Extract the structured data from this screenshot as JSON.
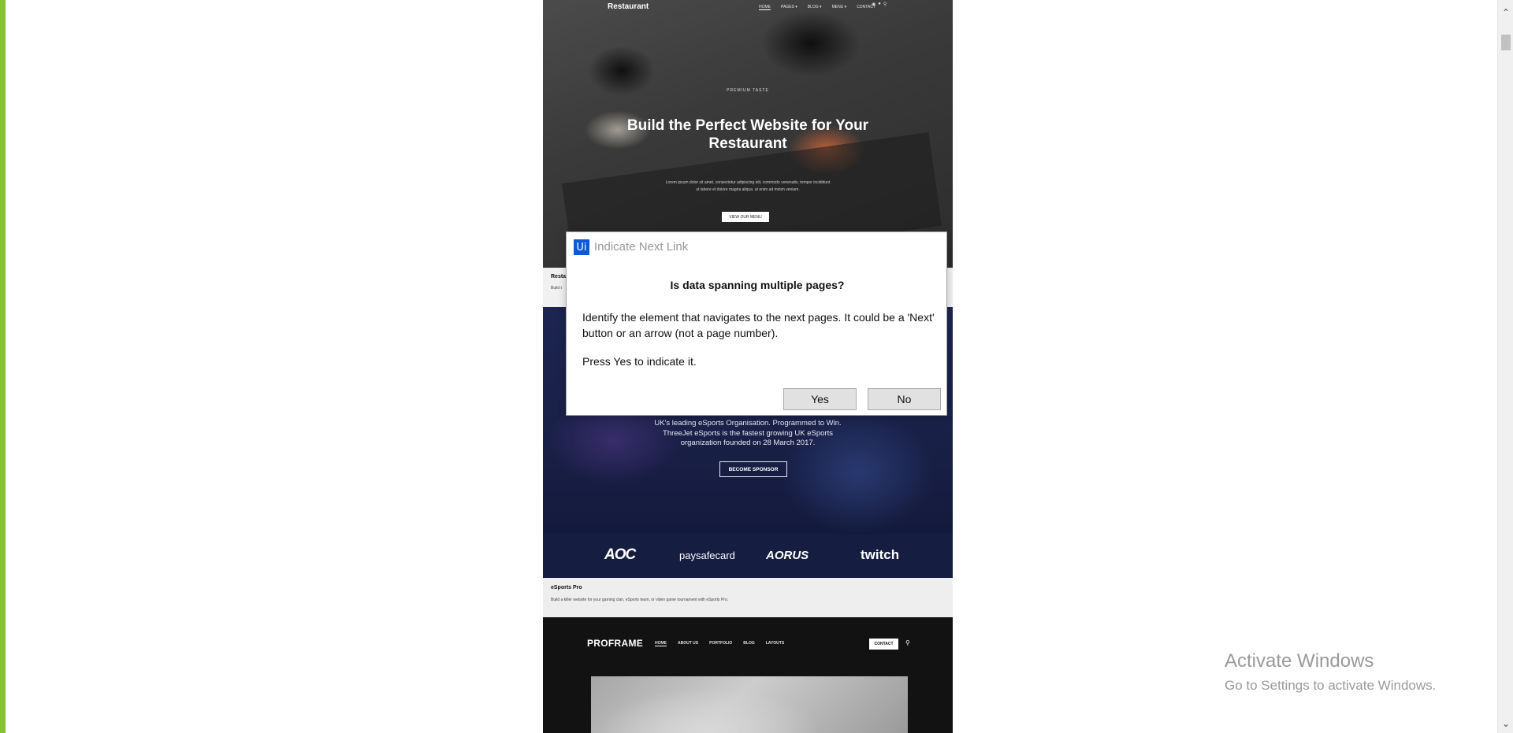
{
  "restaurant_card": {
    "brand": "Restaurant",
    "nav": [
      "HOME",
      "PAGES ▾",
      "BLOG ▾",
      "MENU ▾",
      "CONTACT"
    ],
    "icons": [
      "cart-icon",
      "user-icon",
      "search-icon"
    ],
    "kicker": "PREMIUM TASTE",
    "title": "Build the Perfect Website for Your Restaurant",
    "description": "Lorem ipsum dolor sit amet, consectetur adipiscing elit, commodo venenatis, tempor incididunt ut labore et dolore magna aliqua. ut enim ad minim veniam.",
    "button": "VIEW OUR MENU",
    "caption_title": "Resta",
    "caption_sub": "Build t"
  },
  "esports_card": {
    "text": "UK's leading eSports Organisation. Programmed to Win. ThreeJet eSports is the fastest growing UK eSports organization founded on 28 March 2017.",
    "button": "BECOME SPONSOR",
    "sponsors": [
      "AOC",
      "paysafecard",
      "AORUS",
      "twitch"
    ],
    "caption_title": "eSports Pro",
    "caption_sub": "Build a killer website for your gaming clan, eSports team, or video game tournament with eSports Pro."
  },
  "proframe_card": {
    "brand": "PROFRAME",
    "nav": [
      "HOME",
      "ABOUT US",
      "PORTFOLIO",
      "BLOG",
      "LAYOUTS"
    ],
    "contact": "CONTACT"
  },
  "dialog": {
    "logo": "Ui",
    "title": "Indicate Next Link",
    "heading": "Is data spanning multiple pages?",
    "body": "Identify the element that navigates to the next pages. It could be a 'Next' button or an arrow (not a page number).",
    "press": "Press Yes to indicate it.",
    "yes": "Yes",
    "no": "No"
  },
  "watermark": {
    "title": "Activate Windows",
    "subtitle": "Go to Settings to activate Windows."
  },
  "colors": {
    "edge": "#86c232",
    "uipath_blue": "#0a5bd3"
  }
}
